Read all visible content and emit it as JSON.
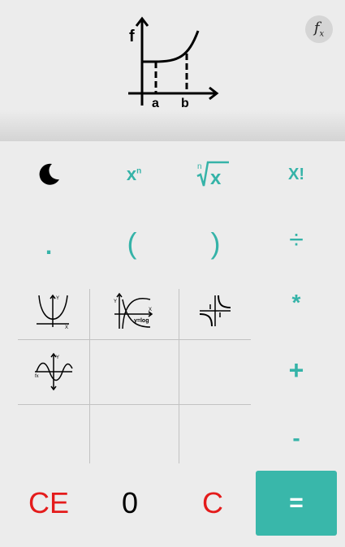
{
  "header": {
    "logo_f": "f",
    "logo_a": "a",
    "logo_b": "b",
    "fx_label": "f",
    "fx_sub": "x"
  },
  "keys": {
    "theme_icon": "moon-icon",
    "power": "x",
    "power_sup": "n",
    "root_index": "n",
    "root_x": "x",
    "factorial": "X!",
    "dot": ".",
    "lparen": "(",
    "rparen": ")",
    "divide": "÷",
    "multiply": "*",
    "plus": "+",
    "minus": "-",
    "clear_entry": "CE",
    "zero": "0",
    "clear": "C",
    "equals": "="
  },
  "graphs": {
    "log_label": "y=log"
  },
  "colors": {
    "accent": "#35b3a8",
    "danger": "#e41b1b",
    "background": "#ececec"
  }
}
